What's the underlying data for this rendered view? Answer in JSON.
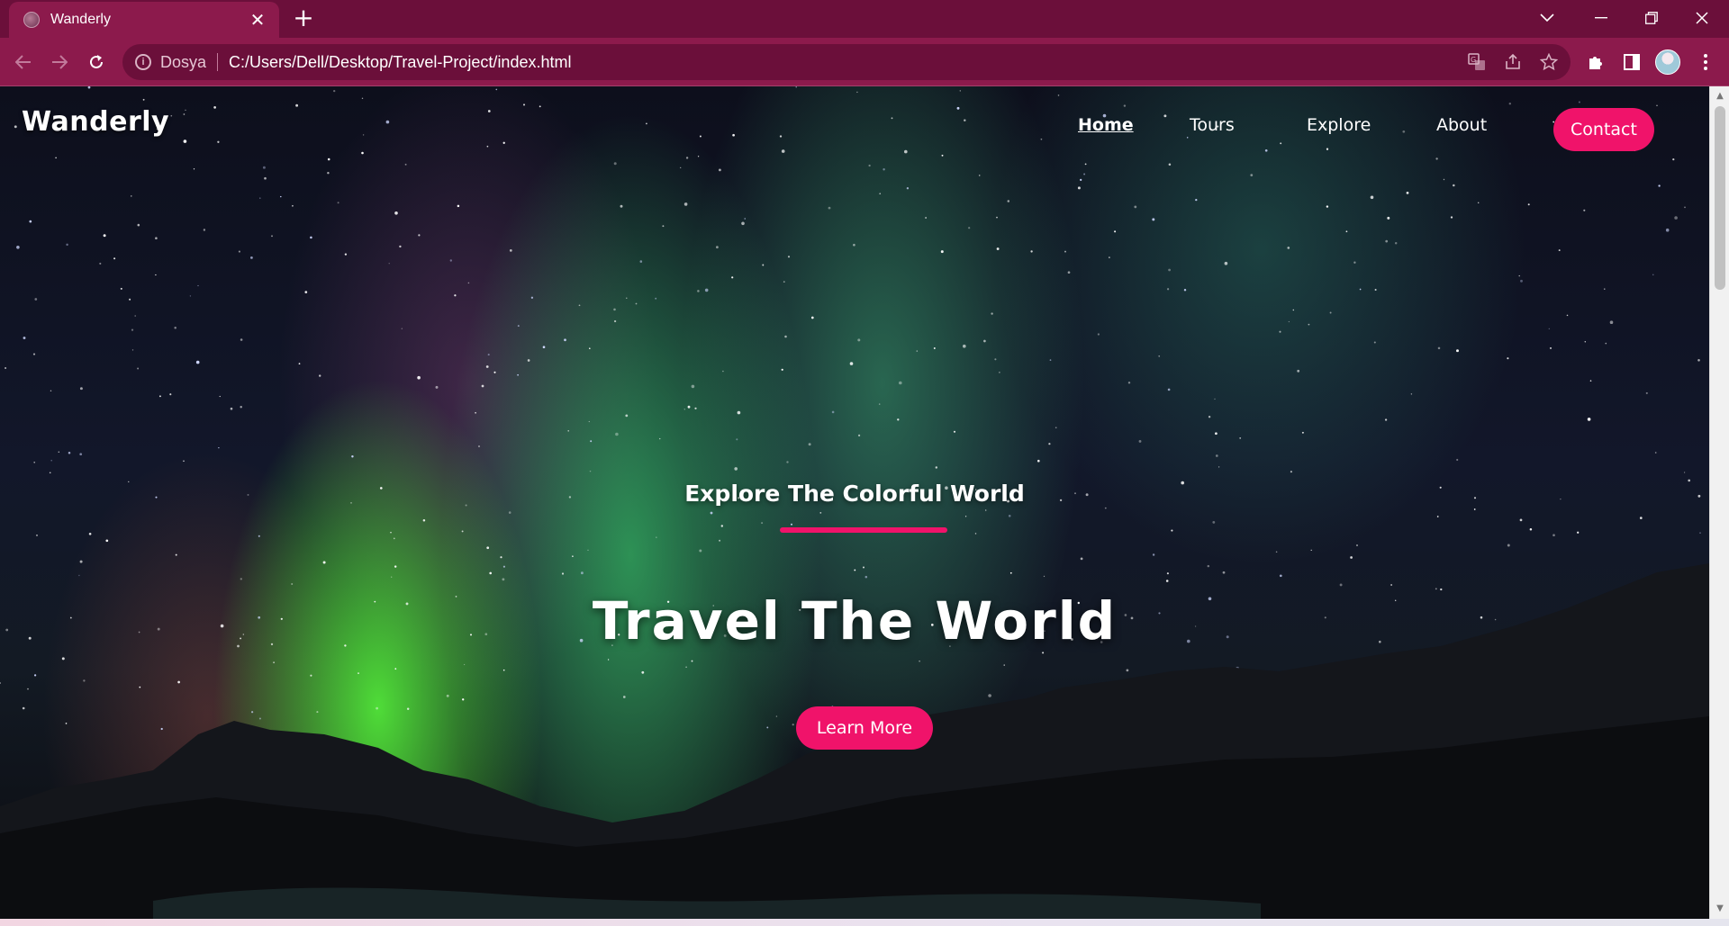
{
  "browser": {
    "tab_title": "Wanderly",
    "tab_close": "✕",
    "new_tab": "+",
    "site_chip": "Dosya",
    "url": "C:/Users/Dell/Desktop/Travel-Project/index.html"
  },
  "site": {
    "logo": "Wanderly",
    "nav": {
      "home": "Home",
      "tours": "Tours",
      "explore": "Explore",
      "about": "About",
      "contact": "Contact"
    },
    "hero": {
      "subtitle": "Explore The Colorful World",
      "title": "Travel The World",
      "button": "Learn More"
    }
  },
  "colors": {
    "tabstrip": "#6b0f3a",
    "toolbar": "#8c1a4c",
    "accent": "#f0136a"
  }
}
